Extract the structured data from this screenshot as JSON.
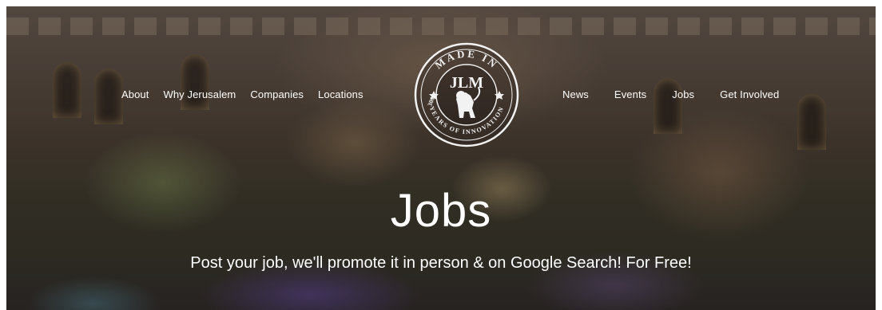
{
  "nav_left": {
    "about": "About",
    "why_jerusalem": "Why Jerusalem",
    "companies": "Companies",
    "locations": "Locations"
  },
  "nav_right": {
    "news": "News",
    "events": "Events",
    "jobs": "Jobs",
    "get_involved": "Get Involved"
  },
  "logo": {
    "arc_top": "MADE IN",
    "name": "JLM",
    "arc_left": "3000",
    "arc_bottom": "YEARS OF INNOVATION",
    "icon": "lion-emblem-icon"
  },
  "hero": {
    "title": "Jobs",
    "subtitle": "Post your job, we'll promote it in person & on Google Search! For Free!"
  },
  "colors": {
    "text": "#ffffff",
    "overlay": "#140f0c"
  }
}
